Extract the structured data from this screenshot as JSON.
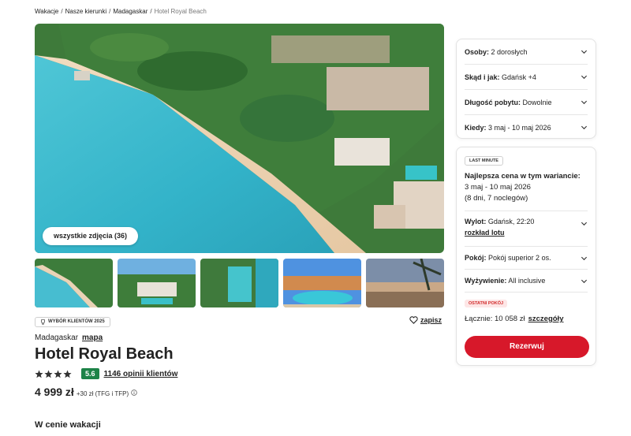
{
  "breadcrumb": {
    "items": [
      "Wakacje",
      "Nasze kierunki",
      "Madagaskar"
    ],
    "current": "Hotel Royal Beach"
  },
  "gallery": {
    "all_photos_label": "wszystkie zdjęcia (36)"
  },
  "hotel": {
    "badge": "WYBÓR KLIENTÓW 2025",
    "save_label": "zapisz",
    "country": "Madagaskar",
    "map_label": "mapa",
    "name": "Hotel Royal Beach",
    "stars": 4,
    "score": "5.6",
    "reviews": "1146 opinii klientów",
    "price": "4 999 zł",
    "price_extra": "+30 zł (TFG i TFP)",
    "section_title": "W cenie wakacji"
  },
  "search_panel": {
    "people": {
      "label": "Osoby:",
      "value": "2 dorosłych"
    },
    "from": {
      "label": "Skąd i jak:",
      "value": "Gdańsk +4"
    },
    "duration": {
      "label": "Długość pobytu:",
      "value": "Dowolnie"
    },
    "when": {
      "label": "Kiedy:",
      "value": "3 maj - 10 maj 2026"
    }
  },
  "offer_panel": {
    "tag": "LAST MINUTE",
    "best_heading": "Najlepsza cena w tym wariancie:",
    "dates": "3 maj - 10 maj 2026",
    "nights": "(8 dni, 7 noclegów)",
    "flight": {
      "label": "Wylot:",
      "value": "Gdańsk, 22:20",
      "link": "rozkład lotu"
    },
    "room": {
      "label": "Pokój:",
      "value": "Pokój superior 2 os."
    },
    "board": {
      "label": "Wyżywienie:",
      "value": "All inclusive"
    },
    "last_room_tag": "OSTATNI POKÓJ",
    "total_label": "Łącznie: 10 058 zł",
    "details_link": "szczegóły",
    "reserve_label": "Rezerwuj"
  },
  "colors": {
    "accent": "#d7182a",
    "score_bg": "#1d8348"
  }
}
